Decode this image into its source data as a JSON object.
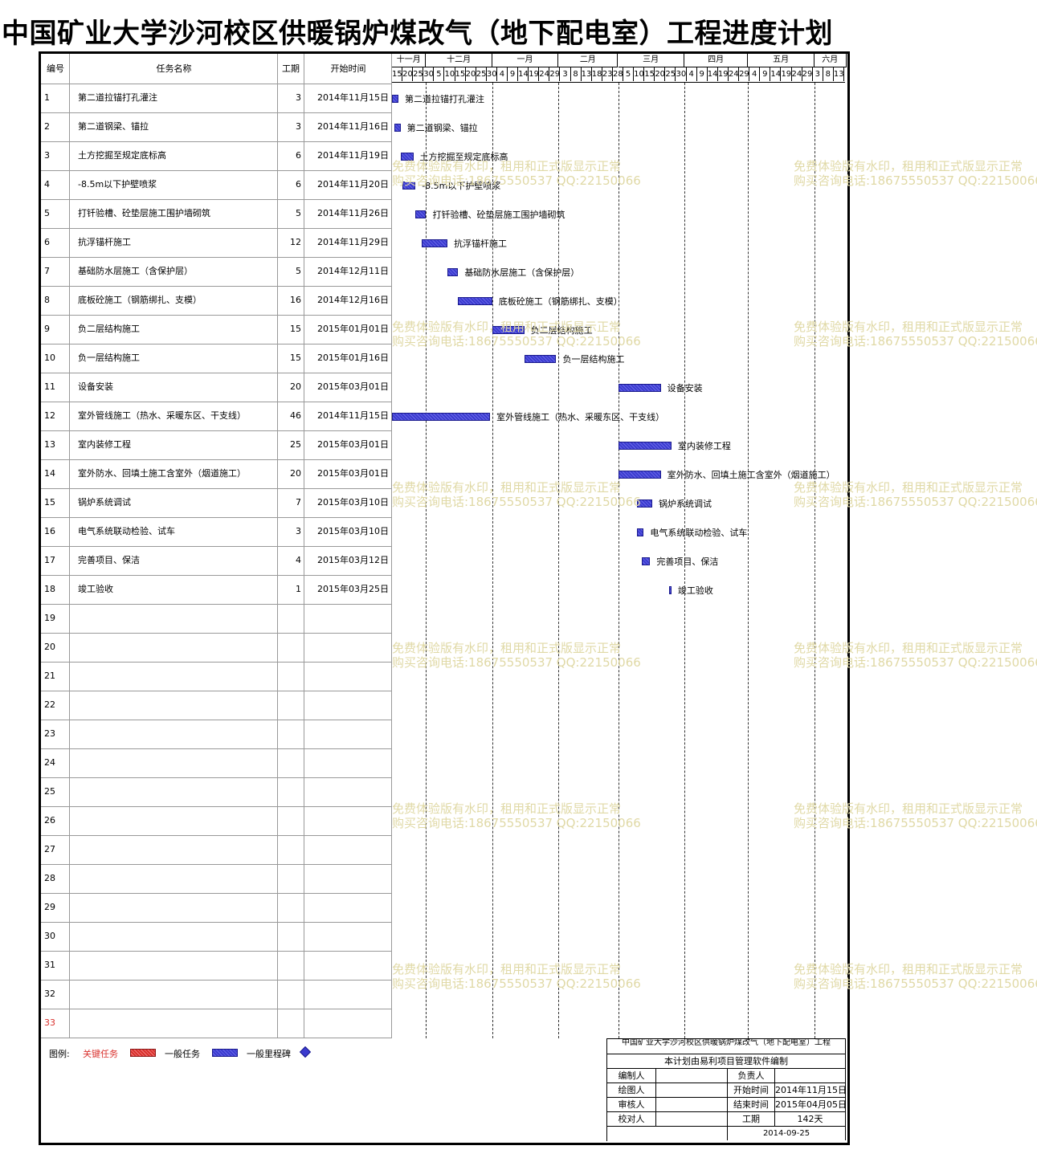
{
  "title": "中国矿业大学沙河校区供暖锅炉煤改气（地下配电室）工程进度计划",
  "columns": {
    "id": "编号",
    "name": "任务名称",
    "duration": "工期",
    "start": "开始时间"
  },
  "months": [
    "十一月",
    "十二月",
    "一月",
    "二月",
    "三月",
    "四月",
    "五月",
    "六月"
  ],
  "days": [
    "15",
    "20",
    "25",
    "30",
    "5",
    "10",
    "15",
    "20",
    "25",
    "30",
    "4",
    "9",
    "14",
    "19",
    "24",
    "29",
    "3",
    "8",
    "13",
    "18",
    "23",
    "28",
    "5",
    "10",
    "15",
    "20",
    "25",
    "30",
    "4",
    "9",
    "14",
    "19",
    "24",
    "29",
    "4",
    "9",
    "14",
    "19",
    "24",
    "29",
    "3",
    "8",
    "13"
  ],
  "chart_data": {
    "type": "gantt",
    "tasks": [
      {
        "id": "1",
        "name": "第二道拉锚打孔灌注",
        "duration": "3",
        "start": "2014年11月15日"
      },
      {
        "id": "2",
        "name": "第二道钢梁、锚拉",
        "duration": "3",
        "start": "2014年11月16日"
      },
      {
        "id": "3",
        "name": "土方挖掘至规定底标高",
        "duration": "6",
        "start": "2014年11月19日"
      },
      {
        "id": "4",
        "name": "-8.5m以下护壁喷浆",
        "duration": "6",
        "start": "2014年11月20日"
      },
      {
        "id": "5",
        "name": "打钎验槽、砼垫层施工围护墙砌筑",
        "duration": "5",
        "start": "2014年11月26日"
      },
      {
        "id": "6",
        "name": "抗浮锚杆施工",
        "duration": "12",
        "start": "2014年11月29日"
      },
      {
        "id": "7",
        "name": "基础防水层施工（含保护层）",
        "duration": "5",
        "start": "2014年12月11日"
      },
      {
        "id": "8",
        "name": "底板砼施工（钢筋绑扎、支模）",
        "duration": "16",
        "start": "2014年12月16日"
      },
      {
        "id": "9",
        "name": "负二层结构施工",
        "duration": "15",
        "start": "2015年01月01日"
      },
      {
        "id": "10",
        "name": "负一层结构施工",
        "duration": "15",
        "start": "2015年01月16日"
      },
      {
        "id": "11",
        "name": "设备安装",
        "duration": "20",
        "start": "2015年03月01日"
      },
      {
        "id": "12",
        "name": "室外管线施工（热水、采暖东区、干支线）",
        "duration": "46",
        "start": "2014年11月15日"
      },
      {
        "id": "13",
        "name": "室内装修工程",
        "duration": "25",
        "start": "2015年03月01日"
      },
      {
        "id": "14",
        "name": "室外防水、回填土施工含室外（烟道施工）",
        "duration": "20",
        "start": "2015年03月01日"
      },
      {
        "id": "15",
        "name": "锅炉系统调试",
        "duration": "7",
        "start": "2015年03月10日"
      },
      {
        "id": "16",
        "name": "电气系统联动检验、试车",
        "duration": "3",
        "start": "2015年03月10日"
      },
      {
        "id": "17",
        "name": "完善项目、保洁",
        "duration": "4",
        "start": "2015年03月12日"
      },
      {
        "id": "18",
        "name": "竣工验收",
        "duration": "1",
        "start": "2015年03月25日"
      }
    ],
    "empty_rows": [
      "19",
      "20",
      "21",
      "22",
      "23",
      "24",
      "25",
      "26",
      "27",
      "28",
      "29",
      "30",
      "31",
      "32",
      "33"
    ]
  },
  "legend": {
    "label": "图例:",
    "critical": "关键任务",
    "normal": "一般任务",
    "milestone": "一般里程碑",
    "critical_color": "#d9302c",
    "normal_color": "#3b3bcf"
  },
  "watermark": {
    "line1": "免费体验版有水印，租用和正式版显示正常",
    "line2": "购买咨询电话:18675550537 QQ:22150066"
  },
  "titleblock": {
    "project": "中国矿业大学沙河校区供暖锅炉煤改气（地下配电室）工程",
    "software": "本计划由易利项目管理软件编制",
    "editor": "编制人",
    "leader": "负责人",
    "drawer": "绘图人",
    "start_label": "开始时间",
    "start_value": "2014年11月15日",
    "reviewer": "审核人",
    "end_label": "结束时间",
    "end_value": "2015年04月05日",
    "checker": "校对人",
    "duration_label": "工期",
    "duration_value": "142天",
    "date": "2014-09-25"
  }
}
